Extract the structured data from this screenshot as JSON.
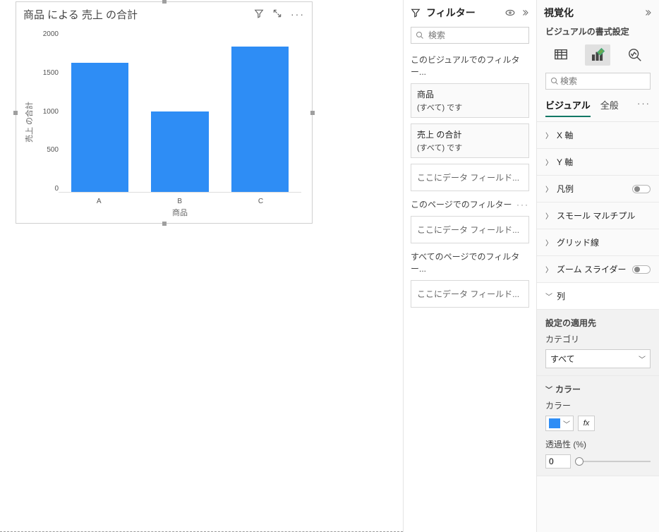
{
  "chart_data": {
    "type": "bar",
    "title": "商品 による 売上 の合計",
    "xlabel": "商品",
    "ylabel": "売上 の合計",
    "categories": [
      "A",
      "B",
      "C"
    ],
    "values": [
      1600,
      1000,
      1800
    ],
    "ylim": [
      0,
      2000
    ],
    "yticks": [
      2000,
      1500,
      1000,
      500,
      0
    ]
  },
  "filters": {
    "title": "フィルター",
    "search_placeholder": "検索",
    "section_visual": "このビジュアルでのフィルター...",
    "card1_field": "商品",
    "card1_value": "(すべて) です",
    "card2_field": "売上 の合計",
    "card2_value": "(すべて) です",
    "drop_visual": "ここにデータ フィールド...",
    "section_page": "このページでのフィルター",
    "drop_page": "ここにデータ フィールド...",
    "section_all": "すべてのページでのフィルター...",
    "drop_all": "ここにデータ フィールド..."
  },
  "viz": {
    "title": "視覚化",
    "subtitle": "ビジュアルの書式設定",
    "search_placeholder": "検索",
    "tab_visual": "ビジュアル",
    "tab_general": "全般",
    "acc": {
      "xaxis": "X 軸",
      "yaxis": "Y 軸",
      "legend": "凡例",
      "small_mult": "スモール マルチプル",
      "grid": "グリッド線",
      "zoom": "ズーム スライダー",
      "columns": "列"
    },
    "apply": {
      "header": "設定の適用先",
      "category": "カテゴリ",
      "category_value": "すべて"
    },
    "color": {
      "header": "カラー",
      "label": "カラー",
      "fx": "fx",
      "opacity_label": "透過性 (%)",
      "opacity_value": "0"
    }
  }
}
